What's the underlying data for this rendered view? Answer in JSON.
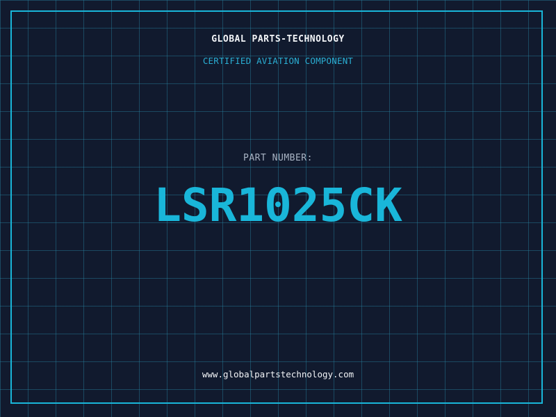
{
  "brand": {
    "name": "GLOBAL PARTS-TECHNOLOGY",
    "tagline": "CERTIFIED AVIATION COMPONENT"
  },
  "part": {
    "label": "PART NUMBER:",
    "number": "LSR1025CK"
  },
  "footer": {
    "website": "www.globalpartstechnology.com"
  },
  "colors": {
    "background": "#111a2e",
    "grid": "#28829f",
    "accent": "#19b6d9",
    "text_primary": "#f2f4f7",
    "text_muted": "#a9b4c4"
  }
}
